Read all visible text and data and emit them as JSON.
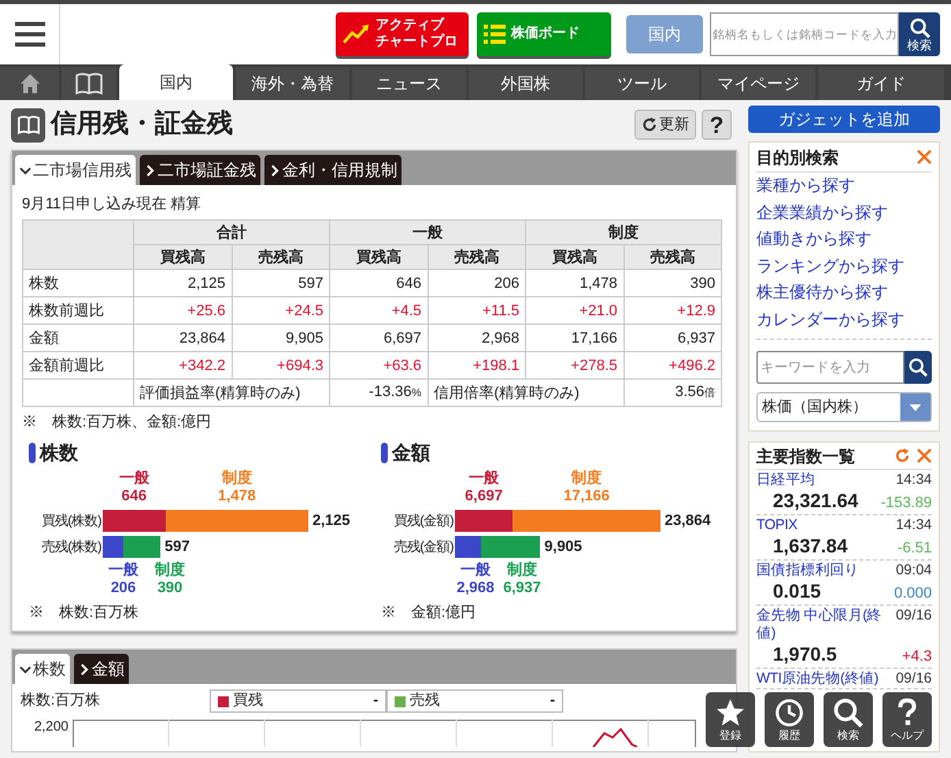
{
  "header": {
    "buttons": [
      {
        "kind": "chart",
        "lines": [
          "アクティブ",
          "チャートプロ"
        ]
      },
      {
        "kind": "board",
        "lines": [
          "株価ボード"
        ]
      }
    ],
    "market_button": "国内",
    "search": {
      "placeholder": "銘柄名もしくは銘柄コードを入力",
      "button": "検索"
    }
  },
  "nav": [
    {
      "kind": "home",
      "selected": false
    },
    {
      "kind": "book",
      "selected": false
    },
    {
      "kind": "text",
      "label": "国内",
      "selected": true
    },
    {
      "kind": "text",
      "label": "海外・為替",
      "selected": false
    },
    {
      "kind": "text",
      "label": "ニュース",
      "selected": false
    },
    {
      "kind": "text",
      "label": "外国株",
      "selected": false
    },
    {
      "kind": "text",
      "label": "ツール",
      "selected": false
    },
    {
      "kind": "text",
      "label": "マイページ",
      "selected": false
    },
    {
      "kind": "text",
      "label": "ガイド",
      "selected": false
    }
  ],
  "page": {
    "title": "信用残・証金残",
    "refresh": "更新",
    "help": "?"
  },
  "tabs": [
    {
      "label": "二市場信用残",
      "selected": true
    },
    {
      "label": "二市場証金残",
      "selected": false
    },
    {
      "label": "金利・信用規制",
      "selected": false
    }
  ],
  "as_of": "9月11日申し込み現在 精算",
  "table": {
    "groups": [
      "合計",
      "一般",
      "制度"
    ],
    "subcolumns": [
      "買残高",
      "売残高",
      "買残高",
      "売残高",
      "買残高",
      "売残高"
    ],
    "rows": [
      {
        "label": "株数",
        "kind": "plain",
        "cells": [
          "2,125",
          "597",
          "646",
          "206",
          "1,478",
          "390"
        ]
      },
      {
        "label": "株数前週比",
        "kind": "change",
        "cells": [
          "+25.6",
          "+24.5",
          "+4.5",
          "+11.5",
          "+21.0",
          "+12.9"
        ]
      },
      {
        "label": "金額",
        "kind": "plain",
        "cells": [
          "23,864",
          "9,905",
          "6,697",
          "2,968",
          "17,166",
          "6,937"
        ]
      },
      {
        "label": "金額前週比",
        "kind": "change",
        "cells": [
          "+342.2",
          "+694.3",
          "+63.6",
          "+198.1",
          "+278.5",
          "+496.2"
        ]
      }
    ],
    "footer": [
      {
        "label": "評価損益率(精算時のみ)",
        "value": "-13.36",
        "unit": "%"
      },
      {
        "label": "信用倍率(精算時のみ)",
        "value": "3.56",
        "unit": "倍"
      }
    ]
  },
  "unit_note": "※　株数:百万株、金額:億円",
  "charts": [
    {
      "title": "株数",
      "note": "※　株数:百万株",
      "rows": [
        {
          "kind": "buy",
          "label": "買残(株数)",
          "total": "2,125",
          "segments": [
            {
              "name": "一般",
              "value": "646",
              "color": "#c41e3a"
            },
            {
              "name": "制度",
              "value": "1,478",
              "color": "#f47c20"
            }
          ]
        },
        {
          "kind": "sell",
          "label": "売残(株数)",
          "total": "597",
          "segments": [
            {
              "name": "一般",
              "value": "206",
              "color": "#3c46c8"
            },
            {
              "name": "制度",
              "value": "390",
              "color": "#1aa050"
            }
          ]
        }
      ]
    },
    {
      "title": "金額",
      "note": "※　金額:億円",
      "rows": [
        {
          "kind": "buy",
          "label": "買残(金額)",
          "total": "23,864",
          "segments": [
            {
              "name": "一般",
              "value": "6,697",
              "color": "#c41e3a"
            },
            {
              "name": "制度",
              "value": "17,166",
              "color": "#f47c20"
            }
          ]
        },
        {
          "kind": "sell",
          "label": "売残(金額)",
          "total": "9,905",
          "segments": [
            {
              "name": "一般",
              "value": "2,968",
              "color": "#3c46c8"
            },
            {
              "name": "制度",
              "value": "6,937",
              "color": "#1aa050"
            }
          ]
        }
      ]
    }
  ],
  "history": {
    "tabs": [
      {
        "label": "株数",
        "selected": true
      },
      {
        "label": "金額",
        "selected": false
      }
    ],
    "unit": "株数:百万株",
    "legend": [
      {
        "label": "買残",
        "value": "-",
        "color": "#c41e3a"
      },
      {
        "label": "売残",
        "value": "-",
        "color": "#6ab04c"
      }
    ],
    "y_tick": "2,200"
  },
  "sidebar": {
    "add_gadget": "ガジェットを追加",
    "search_widget": {
      "title": "目的別検索",
      "links": [
        "業種から探す",
        "企業業績から探す",
        "値動きから探す",
        "ランキングから探す",
        "株主優待から探す",
        "カレンダーから探す"
      ],
      "keyword": {
        "placeholder": "キーワードを入力"
      },
      "select": {
        "value": "株価（国内株）"
      }
    },
    "indices": {
      "title": "主要指数一覧",
      "items": [
        {
          "name": "日経平均",
          "time": "14:34",
          "value": "23,321.64",
          "change": "-153.89",
          "color": "#5cb85c"
        },
        {
          "name": "TOPIX",
          "time": "14:34",
          "value": "1,637.84",
          "change": "-6.51",
          "color": "#5cb85c"
        },
        {
          "name": "国債指標利回り",
          "time": "09:04",
          "value": "0.015",
          "change": "0.000",
          "color": "#3a87c8"
        },
        {
          "name": "金先物 中心限月(終値)",
          "time": "09/16",
          "value": "1,970.5",
          "change": "+4.3",
          "color": "#e8102e"
        },
        {
          "name": "WTI原油先物(終値)",
          "time": "09/16"
        }
      ]
    }
  },
  "float_buttons": [
    {
      "kind": "star",
      "label": "登録"
    },
    {
      "kind": "clock",
      "label": "履歴"
    },
    {
      "kind": "search",
      "label": "検索"
    },
    {
      "kind": "help",
      "label": "ヘルプ"
    }
  ]
}
